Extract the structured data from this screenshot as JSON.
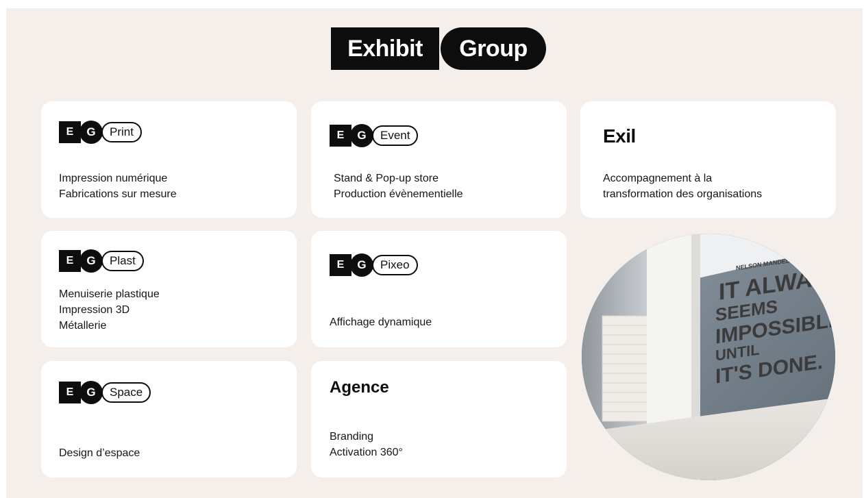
{
  "header": {
    "logo_left": "Exhibit",
    "logo_right": "Group"
  },
  "eg_marks": {
    "e": "E",
    "g": "G"
  },
  "cards": {
    "print": {
      "name": "Print",
      "lines": [
        "Impression numérique",
        "Fabrications sur mesure"
      ]
    },
    "event": {
      "name": "Event",
      "lines": [
        "Stand & Pop-up store",
        "Production évènementielle"
      ]
    },
    "exil": {
      "title": "Exil",
      "lines": [
        "Accompagnement à la",
        "transformation des organisations"
      ]
    },
    "plast": {
      "name": "Plast",
      "lines": [
        "Menuiserie plastique",
        "Impression 3D",
        "Métallerie"
      ]
    },
    "pixeo": {
      "name": "Pixeo",
      "lines": [
        "Affichage dynamique"
      ]
    },
    "space": {
      "name": "Space",
      "lines": [
        "Design d’espace"
      ]
    },
    "agence": {
      "title": "Agence",
      "lines": [
        "Branding",
        "Activation 360°"
      ]
    }
  },
  "photo": {
    "wall_text": [
      "NELSON MANDELA",
      "IT ALWAYS",
      "SEEMS",
      "IMPOSSIBLE",
      "UNTIL",
      "IT'S DONE."
    ]
  },
  "colors": {
    "background": "#f5efec",
    "card": "#ffffff",
    "brand": "#0d0d0d"
  }
}
